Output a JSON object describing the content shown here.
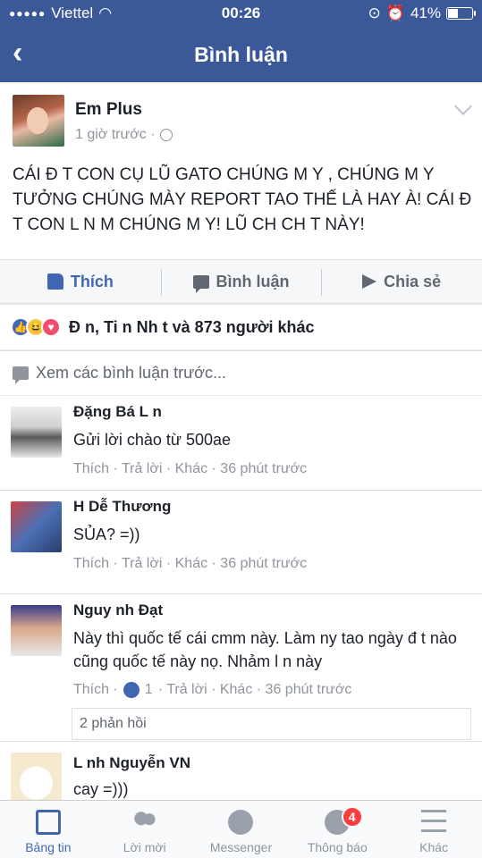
{
  "status": {
    "carrier": "Viettel",
    "time": "00:26",
    "battery": "41%"
  },
  "nav": {
    "title": "Bình luận"
  },
  "post": {
    "author": "Em Plus",
    "time": "1 giờ trước ·",
    "body": "CÁI Đ T CON CỤ LŨ GATO CHÚNG M Y , CHÚNG M Y TƯỞNG CHÚNG MÀY REPORT TAO THẾ LÀ HAY À! CÁI Đ T CON L N M CHÚNG M Y! LŨ CH CH T NÀY!"
  },
  "actions": {
    "like": "Thích",
    "comment": "Bình luận",
    "share": "Chia sẻ"
  },
  "reactions": {
    "text": "Đ n, Ti n Nh t và 873 người khác"
  },
  "previous_comments": "Xem các bình luận trước...",
  "comments": [
    {
      "name": "Đặng Bá L n",
      "text": "Gửi lời chào từ 500ae",
      "meta": "Thích · Trả lời · Khác · 36 phút trước"
    },
    {
      "name": "H  Dễ Thương",
      "text": "SỦA? =))",
      "meta": "Thích · Trả lời · Khác · 36 phút trước"
    },
    {
      "name": "Nguy  nh Đạt",
      "text": "Này thì quốc tế cái cmm này. Làm ny tao ngày đ t nào cũng quốc tế này nọ. Nhảm l n này",
      "meta_prefix": "Thích ·",
      "likes": "1",
      "meta_suffix": "· Trả lời · Khác · 36 phút trước",
      "replies": "2 phản hồi"
    },
    {
      "name": "L nh Nguyễn VN",
      "text": "cay =)))"
    }
  ],
  "tabs": [
    {
      "label": "Bảng tin",
      "icon": "news-feed-icon",
      "active": true
    },
    {
      "label": "Lời mời",
      "icon": "friend-requests-icon"
    },
    {
      "label": "Messenger",
      "icon": "messenger-icon"
    },
    {
      "label": "Thông báo",
      "icon": "notifications-icon",
      "badge": "4"
    },
    {
      "label": "Khác",
      "icon": "menu-icon"
    }
  ],
  "colors": {
    "brand": "#3b5998",
    "link": "#4267b2",
    "badge": "#fa3e3e"
  }
}
